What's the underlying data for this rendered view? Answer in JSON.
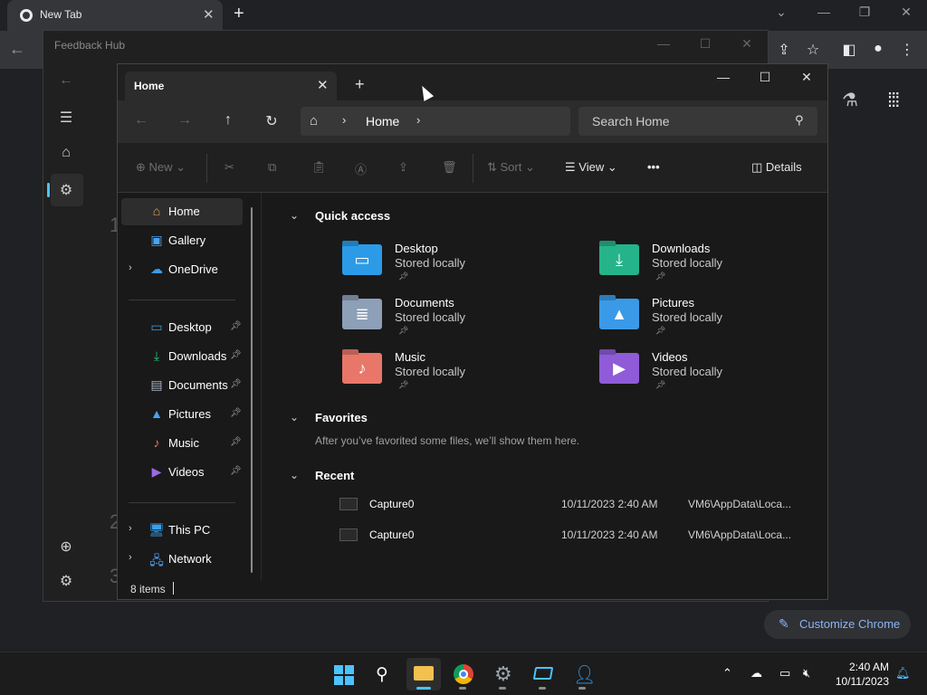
{
  "chrome": {
    "tab_title": "New Tab",
    "tab_close": "✕",
    "new_tab": "+",
    "customize_label": "Customize Chrome"
  },
  "feedback_hub": {
    "title": "Feedback Hub",
    "digits": [
      "1",
      "2",
      "3"
    ]
  },
  "explorer": {
    "tab_label": "Home",
    "tab_close": "✕",
    "new_tab": "+",
    "address": {
      "crumb": "Home",
      "separator": "›"
    },
    "search": {
      "placeholder": "Search Home"
    },
    "commands": {
      "new": "New",
      "sort": "Sort",
      "view": "View",
      "more": "•••",
      "details": "Details"
    },
    "sidebar": {
      "top": [
        {
          "label": "Home",
          "icon": "home-icon"
        },
        {
          "label": "Gallery",
          "icon": "gallery-icon"
        },
        {
          "label": "OneDrive",
          "icon": "cloud-icon"
        }
      ],
      "pinned": [
        {
          "label": "Desktop",
          "icon": "desktop-icon"
        },
        {
          "label": "Downloads",
          "icon": "download-icon"
        },
        {
          "label": "Documents",
          "icon": "documents-icon"
        },
        {
          "label": "Pictures",
          "icon": "pictures-icon"
        },
        {
          "label": "Music",
          "icon": "music-icon"
        },
        {
          "label": "Videos",
          "icon": "videos-icon"
        }
      ],
      "bottom": [
        {
          "label": "This PC",
          "icon": "pc-icon"
        },
        {
          "label": "Network",
          "icon": "network-icon"
        }
      ]
    },
    "sections": {
      "quick_access": "Quick access",
      "favorites": "Favorites",
      "favorites_hint": "After you’ve favorited some files, we’ll show them here.",
      "recent": "Recent"
    },
    "quick_access": [
      {
        "name": "Desktop",
        "sub": "Stored locally",
        "color": "#2b9be8"
      },
      {
        "name": "Downloads",
        "sub": "Stored locally",
        "color": "#25b38a"
      },
      {
        "name": "Documents",
        "sub": "Stored locally",
        "color": "#8e9fb8"
      },
      {
        "name": "Pictures",
        "sub": "Stored locally",
        "color": "#3a9ae8"
      },
      {
        "name": "Music",
        "sub": "Stored locally",
        "color": "#e8776a"
      },
      {
        "name": "Videos",
        "sub": "Stored locally",
        "color": "#8f5bd8"
      }
    ],
    "recent": [
      {
        "name": "Capture0",
        "date": "10/11/2023 2:40 AM",
        "path": "VM6\\AppData\\Loca..."
      },
      {
        "name": "Capture0",
        "date": "10/11/2023 2:40 AM",
        "path": "VM6\\AppData\\Loca..."
      }
    ],
    "status": "8 items"
  },
  "taskbar": {
    "time": "2:40 AM",
    "date": "10/11/2023"
  }
}
